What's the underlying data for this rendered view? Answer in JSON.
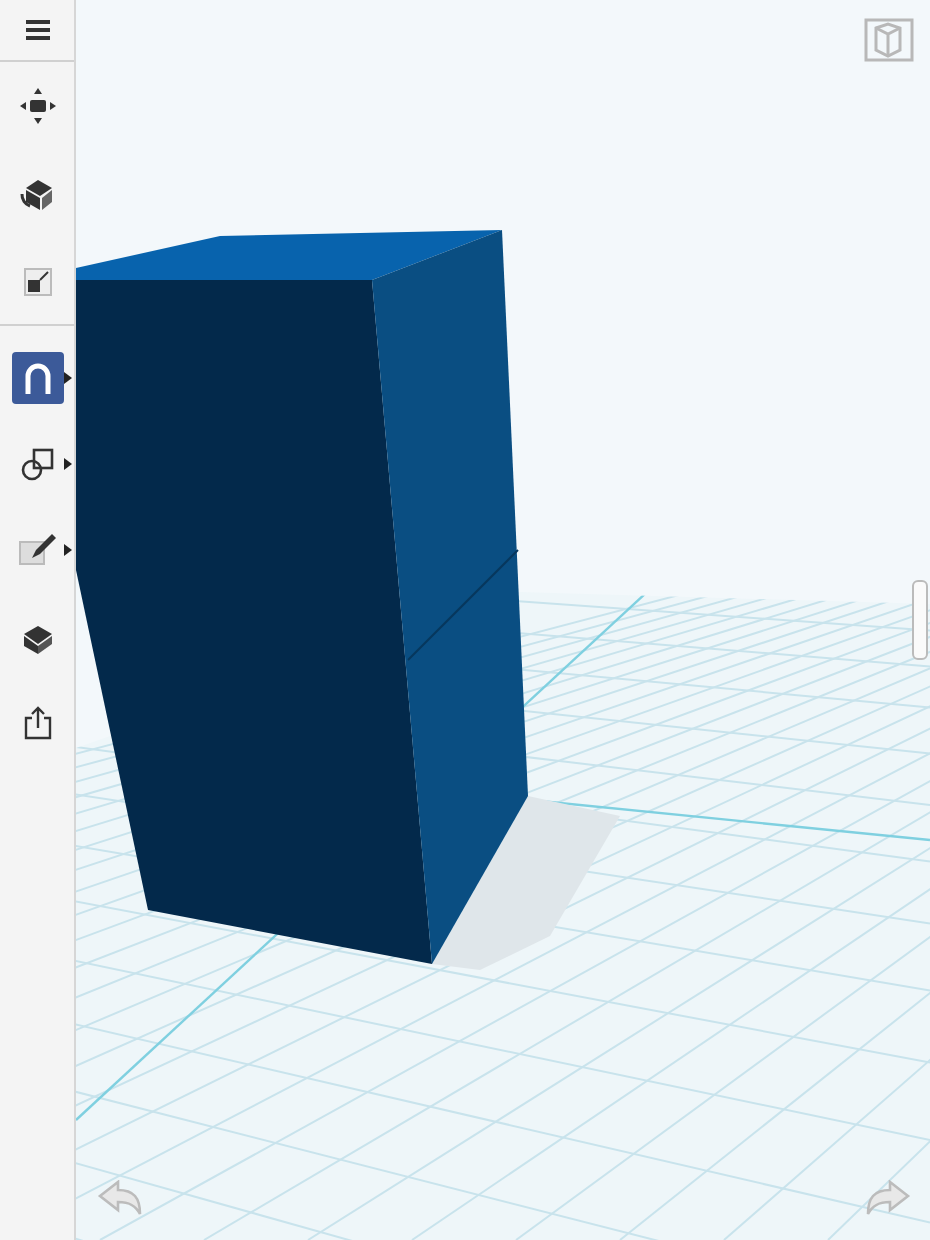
{
  "toolbar": {
    "tools": [
      {
        "kind": "menu",
        "selected": false,
        "submenu": false
      },
      {
        "kind": "move",
        "selected": false,
        "submenu": false
      },
      {
        "kind": "rotate",
        "selected": false,
        "submenu": false
      },
      {
        "kind": "scale",
        "selected": false,
        "submenu": false
      },
      {
        "kind": "magnet",
        "selected": true,
        "submenu": true
      },
      {
        "kind": "shapes",
        "selected": false,
        "submenu": true
      },
      {
        "kind": "sketch",
        "selected": false,
        "submenu": true
      },
      {
        "kind": "material",
        "selected": false,
        "submenu": false
      },
      {
        "kind": "export",
        "selected": false,
        "submenu": false
      }
    ]
  }
}
